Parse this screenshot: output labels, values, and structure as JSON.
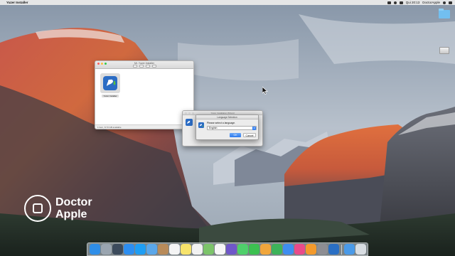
{
  "menubar": {
    "apple": "",
    "app_name": "Yuzer Installer",
    "clock": "Qui 20:13",
    "user": "DoctorApple"
  },
  "desktop": {
    "icons": [
      {
        "name": "folder"
      },
      {
        "name": "drive"
      }
    ]
  },
  "finder": {
    "title": "Mr. Yuzer Installer",
    "item_label": "Yuzer Installer",
    "status": "1 item, 8.73 GB available"
  },
  "installer": {
    "title": "Yuzer Installation Wizard"
  },
  "dialog": {
    "title": "Language Selection",
    "prompt": "Please select a language.",
    "selected_language": "English",
    "ok_label": "OK",
    "cancel_label": "Cancel"
  },
  "watermark": {
    "line1": "Doctor",
    "line2": "Apple"
  },
  "dock": {
    "items": [
      {
        "icon": "finder-icon",
        "color": "#2f8ee8"
      },
      {
        "icon": "launchpad-icon",
        "color": "#9aa5b0"
      },
      {
        "icon": "mission-control-icon",
        "color": "#3c4b5c"
      },
      {
        "icon": "safari-icon",
        "color": "#2d8ef0"
      },
      {
        "icon": "app-store-icon",
        "color": "#1e9ef4"
      },
      {
        "icon": "mail-icon",
        "color": "#5aa7ea"
      },
      {
        "icon": "contacts-icon",
        "color": "#b88b5a"
      },
      {
        "icon": "calendar-icon",
        "color": "#f4f4f4"
      },
      {
        "icon": "notes-icon",
        "color": "#f7e36b"
      },
      {
        "icon": "reminders-icon",
        "color": "#f2f2f2"
      },
      {
        "icon": "maps-icon",
        "color": "#7cc46a"
      },
      {
        "icon": "photos-icon",
        "color": "#f6f6f6"
      },
      {
        "icon": "imovie-icon",
        "color": "#6f57c9"
      },
      {
        "icon": "messages-icon",
        "color": "#4fd06b"
      },
      {
        "icon": "facetime-icon",
        "color": "#3cc051"
      },
      {
        "icon": "pages-icon",
        "color": "#f0a63c"
      },
      {
        "icon": "numbers-icon",
        "color": "#3db35a"
      },
      {
        "icon": "keynote-icon",
        "color": "#3f8ef0"
      },
      {
        "icon": "itunes-icon",
        "color": "#e94b8a"
      },
      {
        "icon": "ibooks-icon",
        "color": "#f39a2c"
      },
      {
        "icon": "system-preferences-icon",
        "color": "#8e8e93"
      },
      {
        "icon": "installer-icon",
        "color": "#2a6fc4"
      },
      {
        "icon": "downloads-icon",
        "color": "#4a9ae8"
      },
      {
        "icon": "trash-icon",
        "color": "#d8dde2"
      }
    ]
  }
}
